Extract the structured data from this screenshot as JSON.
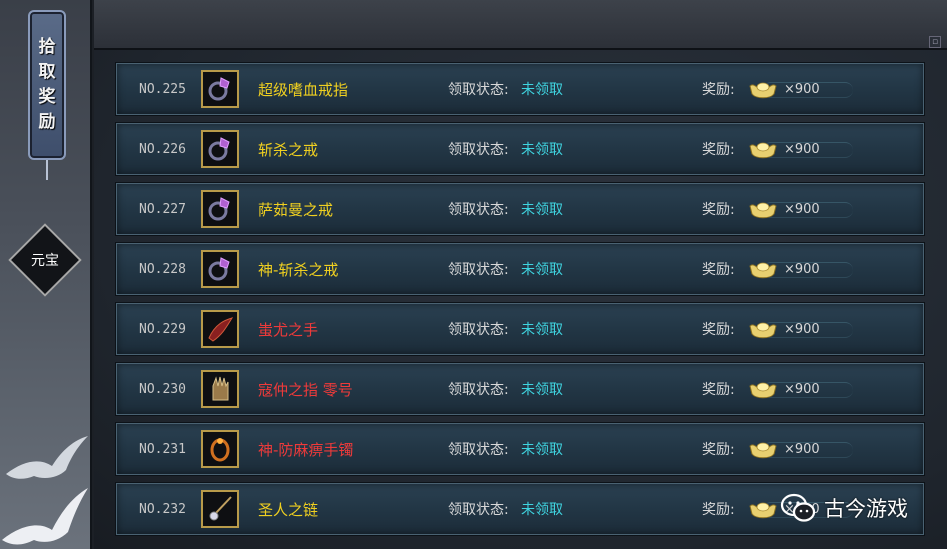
{
  "sidebar": {
    "banner_chars": [
      "拾",
      "取",
      "奖",
      "励"
    ],
    "tab_label": "元宝"
  },
  "rows": [
    {
      "no": "NO.225",
      "item_name": "超级嗜血戒指",
      "name_color": "#f0d020",
      "status_label": "领取状态:",
      "status_value": "未领取",
      "reward_label": "奖励:",
      "qty": "×900",
      "icon": "ring-icon"
    },
    {
      "no": "NO.226",
      "item_name": "斩杀之戒",
      "name_color": "#f0d020",
      "status_label": "领取状态:",
      "status_value": "未领取",
      "reward_label": "奖励:",
      "qty": "×900",
      "icon": "ring-icon"
    },
    {
      "no": "NO.227",
      "item_name": "萨茹曼之戒",
      "name_color": "#f0d020",
      "status_label": "领取状态:",
      "status_value": "未领取",
      "reward_label": "奖励:",
      "qty": "×900",
      "icon": "ring-icon"
    },
    {
      "no": "NO.228",
      "item_name": "神-斩杀之戒",
      "name_color": "#f0d020",
      "status_label": "领取状态:",
      "status_value": "未领取",
      "reward_label": "奖励:",
      "qty": "×900",
      "icon": "ring-icon"
    },
    {
      "no": "NO.229",
      "item_name": "蚩尤之手",
      "name_color": "#ee3a3a",
      "status_label": "领取状态:",
      "status_value": "未领取",
      "reward_label": "奖励:",
      "qty": "×900",
      "icon": "claw-icon"
    },
    {
      "no": "NO.230",
      "item_name": "寇仲之指 零号",
      "name_color": "#ee3a3a",
      "status_label": "领取状态:",
      "status_value": "未领取",
      "reward_label": "奖励:",
      "qty": "×900",
      "icon": "gauntlet-icon"
    },
    {
      "no": "NO.231",
      "item_name": "神-防麻痹手镯",
      "name_color": "#ee3a3a",
      "status_label": "领取状态:",
      "status_value": "未领取",
      "reward_label": "奖励:",
      "qty": "×900",
      "icon": "bracelet-icon"
    },
    {
      "no": "NO.232",
      "item_name": "圣人之链",
      "name_color": "#f0d020",
      "status_label": "领取状态:",
      "status_value": "未领取",
      "reward_label": "奖励:",
      "qty": "×900",
      "icon": "necklace-icon"
    }
  ],
  "watermark": {
    "text": "古今游戏",
    "icon": "wechat-icon"
  },
  "colors": {
    "status_value": "#3fd4e0",
    "item_border": "#b89a4a",
    "gold": "#e8d070"
  }
}
